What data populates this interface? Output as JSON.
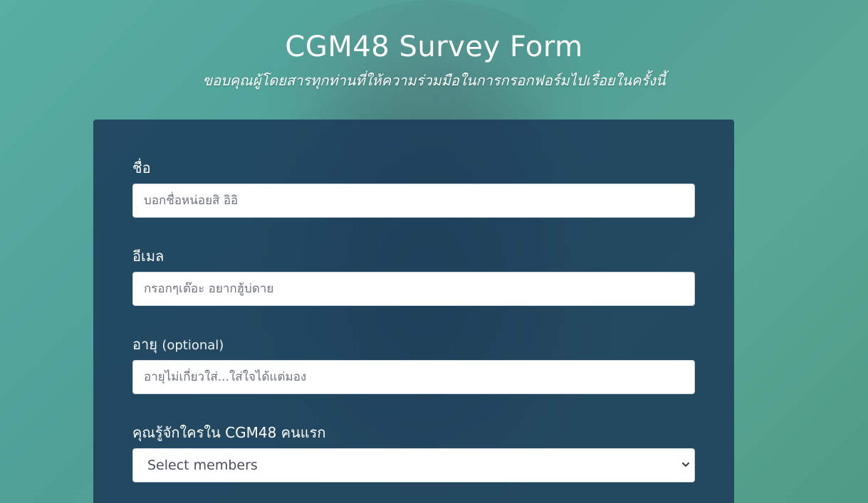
{
  "header": {
    "title": "CGM48 Survey Form",
    "subtitle": "ขอบคุณผู้โดยสารทุกท่านที่ให้ความร่วมมือในการกรอกฟอร์มไปเรื่อยในครั้งนี้"
  },
  "form": {
    "name": {
      "label": "ชื่อ",
      "placeholder": "บอกชื่อหน่อยสิ อิอิ",
      "value": ""
    },
    "email": {
      "label": "อีเมล",
      "placeholder": "กรอกๆเต๊อะ อยากฮู้บ่ดาย",
      "value": ""
    },
    "age": {
      "label": "อายุ",
      "optional": "(optional)",
      "placeholder": "อายุไม่เกี่ยวใส่...ใส่ใจได้แต่มอง",
      "value": ""
    },
    "first_member": {
      "label": "คุณรู้จักใครใน CGM48 คนแรก",
      "selected": "Select members"
    }
  },
  "colors": {
    "background_teal": "#5aa89c",
    "card_navy": "#1b3a58",
    "input_text": "#495057",
    "placeholder": "#6c757d",
    "heading_white": "#ffffff"
  },
  "icons": {
    "select_arrow": "chevron-down-icon"
  }
}
